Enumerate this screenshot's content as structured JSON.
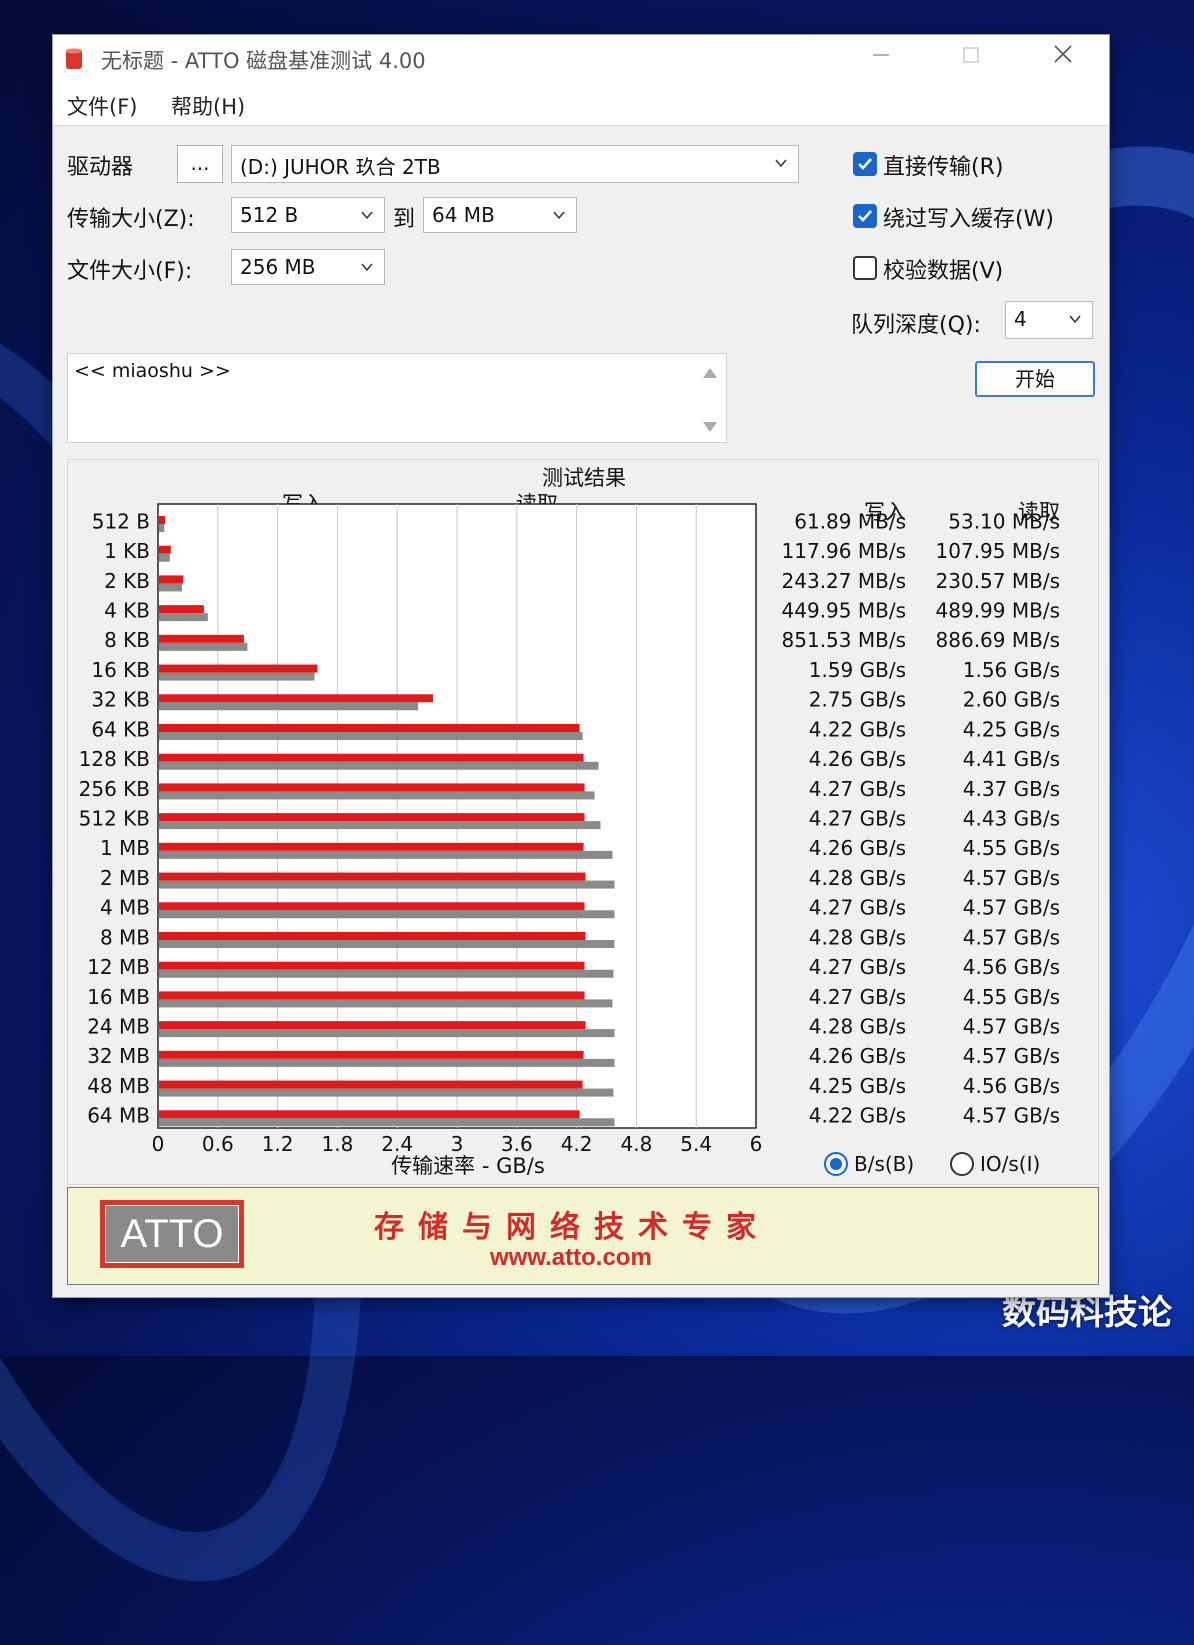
{
  "watermark": "数码科技论",
  "window": {
    "title": "无标题 - ATTO 磁盘基准测试 4.00"
  },
  "menu": [
    "文件(F)",
    "帮助(H)"
  ],
  "controls": {
    "drive_label": "驱动器",
    "browse_label": "...",
    "drive_value": "(D:) JUHOR 玖合 2TB",
    "transfer_label": "传输大小(Z):",
    "transfer_from": "512 B",
    "to_label": "到",
    "transfer_to": "64 MB",
    "file_size_label": "文件大小(F):",
    "file_size": "256 MB",
    "direct_io": {
      "label": "直接传输(R)",
      "checked": true
    },
    "bypass_cache": {
      "label": "绕过写入缓存(W)",
      "checked": true
    },
    "verify": {
      "label": "校验数据(V)",
      "checked": false
    },
    "queue_label": "队列深度(Q):",
    "queue_value": "4",
    "start_label": "开始",
    "description": "<< miaoshu >>"
  },
  "results": {
    "col_write": "写入",
    "col_read": "读取",
    "unit_bytes": "B/s(B)",
    "unit_io": "IO/s(I)",
    "unit_selected": "bytes"
  },
  "banner": {
    "logo": "ATTO",
    "slogan": "存储与网络技术专家",
    "url": "www.atto.com"
  },
  "colors": {
    "write": "#e01a1a",
    "read": "#8a8a8a",
    "accent": "#1a66c8"
  },
  "chart_data": {
    "type": "bar",
    "orientation": "horizontal",
    "title": "测试结果",
    "xlabel": "传输速率 - GB/s",
    "xlim": [
      0,
      6
    ],
    "xticks": [
      "0",
      "0.6",
      "1.2",
      "1.8",
      "2.4",
      "3",
      "3.6",
      "4.2",
      "4.8",
      "5.4",
      "6"
    ],
    "categories": [
      "512 B",
      "1 KB",
      "2 KB",
      "4 KB",
      "8 KB",
      "16 KB",
      "32 KB",
      "64 KB",
      "128 KB",
      "256 KB",
      "512 KB",
      "1 MB",
      "2 MB",
      "4 MB",
      "8 MB",
      "12 MB",
      "16 MB",
      "24 MB",
      "32 MB",
      "48 MB",
      "64 MB"
    ],
    "series": [
      {
        "name": "写入",
        "values": [
          0.0619,
          0.118,
          0.2433,
          0.45,
          0.8515,
          1.59,
          2.75,
          4.22,
          4.26,
          4.27,
          4.27,
          4.26,
          4.28,
          4.27,
          4.28,
          4.27,
          4.27,
          4.28,
          4.26,
          4.25,
          4.22
        ],
        "labels": [
          "61.89 MB/s",
          "117.96 MB/s",
          "243.27 MB/s",
          "449.95 MB/s",
          "851.53 MB/s",
          "1.59 GB/s",
          "2.75 GB/s",
          "4.22 GB/s",
          "4.26 GB/s",
          "4.27 GB/s",
          "4.27 GB/s",
          "4.26 GB/s",
          "4.28 GB/s",
          "4.27 GB/s",
          "4.28 GB/s",
          "4.27 GB/s",
          "4.27 GB/s",
          "4.28 GB/s",
          "4.26 GB/s",
          "4.25 GB/s",
          "4.22 GB/s"
        ]
      },
      {
        "name": "读取",
        "values": [
          0.0531,
          0.108,
          0.2306,
          0.49,
          0.8867,
          1.56,
          2.6,
          4.25,
          4.41,
          4.37,
          4.43,
          4.55,
          4.57,
          4.57,
          4.57,
          4.56,
          4.55,
          4.57,
          4.57,
          4.56,
          4.57
        ],
        "labels": [
          "53.10 MB/s",
          "107.95 MB/s",
          "230.57 MB/s",
          "489.99 MB/s",
          "886.69 MB/s",
          "1.56 GB/s",
          "2.60 GB/s",
          "4.25 GB/s",
          "4.41 GB/s",
          "4.37 GB/s",
          "4.43 GB/s",
          "4.55 GB/s",
          "4.57 GB/s",
          "4.57 GB/s",
          "4.57 GB/s",
          "4.56 GB/s",
          "4.55 GB/s",
          "4.57 GB/s",
          "4.57 GB/s",
          "4.56 GB/s",
          "4.57 GB/s"
        ]
      }
    ]
  }
}
